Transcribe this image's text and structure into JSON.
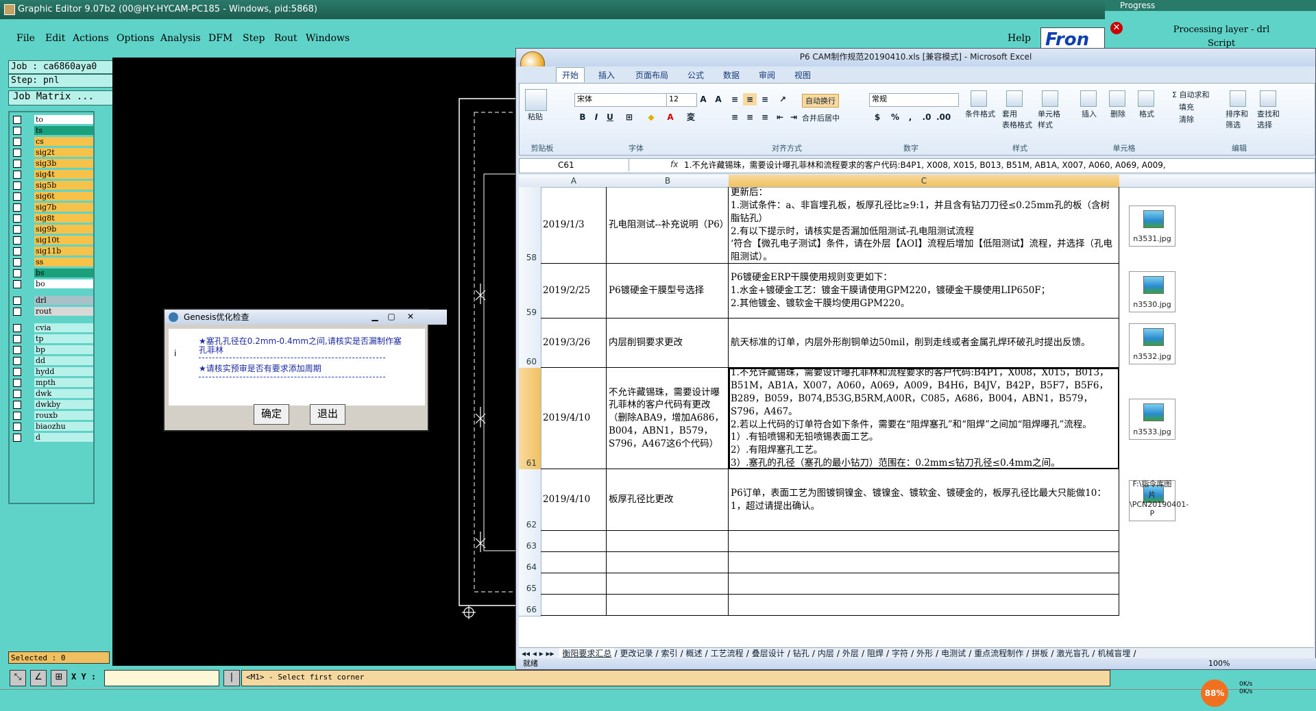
{
  "ge": {
    "title": "Graphic Editor 9.07b2 (00@HY-HYCAM-PC185 - Windows, pid:5868)",
    "menus": [
      "File",
      "Edit",
      "Actions",
      "Options",
      "Analysis",
      "DFM",
      "Step",
      "Rout",
      "Windows"
    ],
    "help": "Help",
    "brand": "Fron",
    "job_label": "Job : ca6860aya0",
    "step_label": "Step: pnl",
    "job_matrix": "Job Matrix ...",
    "layers_group1": [
      {
        "name": "to",
        "color": "#ffffff"
      },
      {
        "name": "ts",
        "color": "#1aa07a"
      },
      {
        "name": "cs",
        "color": "#f6c24a"
      },
      {
        "name": "sig2t",
        "color": "#f6c24a"
      },
      {
        "name": "sig3b",
        "color": "#f6c24a"
      },
      {
        "name": "sig4t",
        "color": "#f6c24a"
      },
      {
        "name": "sig5b",
        "color": "#f6c24a"
      },
      {
        "name": "sig6t",
        "color": "#f6c24a"
      },
      {
        "name": "sig7b",
        "color": "#f6c24a"
      },
      {
        "name": "sig8t",
        "color": "#f6c24a"
      },
      {
        "name": "sig9b",
        "color": "#f6c24a"
      },
      {
        "name": "sig10t",
        "color": "#f6c24a"
      },
      {
        "name": "sig11b",
        "color": "#f6c24a"
      },
      {
        "name": "ss",
        "color": "#f6c24a"
      },
      {
        "name": "bs",
        "color": "#1aa07a"
      },
      {
        "name": "bo",
        "color": "#ffffff"
      }
    ],
    "layers_group2": [
      {
        "name": "drl",
        "color": "#a8c0c8"
      },
      {
        "name": "rout",
        "color": "#d8d8d8"
      }
    ],
    "layers_group3": [
      {
        "name": "cvia",
        "color": "#b8f0ea"
      },
      {
        "name": "tp",
        "color": "#b8f0ea"
      },
      {
        "name": "bp",
        "color": "#b8f0ea"
      },
      {
        "name": "dd",
        "color": "#b8f0ea"
      },
      {
        "name": "hydd",
        "color": "#b8f0ea"
      },
      {
        "name": "mpth",
        "color": "#b8f0ea"
      },
      {
        "name": "dwk",
        "color": "#b8f0ea"
      },
      {
        "name": "dwkby",
        "color": "#b8f0ea"
      },
      {
        "name": "rouxb",
        "color": "#b8f0ea"
      },
      {
        "name": "biaozhu",
        "color": "#b8f0ea"
      },
      {
        "name": "d",
        "color": "#b8f0ea"
      }
    ],
    "selected": "Selected : 0",
    "xy_label": "X Y :",
    "prompt": "<M1> - Select first corner"
  },
  "progress": {
    "title": "Progress",
    "line1": "Processing layer - drl",
    "line2": "Script"
  },
  "genesis": {
    "title": "Genesis优化检查",
    "msg1": "★塞孔孔径在0.2mm-0.4mm之间,请核实是否漏制作塞孔菲林",
    "msg2": "★请核实预审是否有要求添加周期",
    "ok": "确定",
    "exit": "退出"
  },
  "excel": {
    "title": "P6 CAM制作规范20190410.xls  [兼容模式] - Microsoft Excel",
    "tabs": [
      "开始",
      "插入",
      "页面布局",
      "公式",
      "数据",
      "审阅",
      "视图"
    ],
    "ribbon": {
      "paste": "粘贴",
      "clipboard": "剪贴板",
      "font_name": "宋体",
      "font_size": "12",
      "font": "字体",
      "wrap": "自动换行",
      "merge": "合并后居中",
      "align": "对齐方式",
      "number_format": "常规",
      "number": "数字",
      "cond_format": "条件格式",
      "table_format": "套用\n表格格式",
      "cell_style": "单元格\n样式",
      "styles": "样式",
      "insert": "插入",
      "delete": "删除",
      "format": "格式",
      "cells": "单元格",
      "autosum": "Σ 自动求和",
      "fill": "填充",
      "clear": "清除",
      "sort": "排序和\n筛选",
      "find": "查找和\n选择",
      "editing": "编辑"
    },
    "namebox": "C61",
    "formula": "1.不允许藏锡珠，需要设计曝孔菲林和流程要求的客户代码:B4P1, X008, X015, B013, B51M, AB1A, X007, A060, A069, A009,",
    "columns": [
      "A",
      "B",
      "C"
    ],
    "rows": [
      {
        "num": "58",
        "date": "2019/1/3",
        "title": "孔电阻测试--补充说明（P6）",
        "content": "更新后：\n1.测试条件：a、非盲埋孔板，板厚孔径比≥9:1，并且含有钻刀刀径≤0.25mm孔的板（含树脂钻孔）\n2.有以下提示时，请核实是否漏加低阻测试-孔电阻测试流程\n‘符合【微孔电子测试】条件，请在外层【AOI】流程后增加【低阻测试】流程，并选择（孔电阻测试）。",
        "image": "n3531.jpg"
      },
      {
        "num": "59",
        "date": "2019/2/25",
        "title": "P6镀硬金干膜型号选择",
        "content": "P6镀硬金ERP干膜使用规则变更如下：\n1.水金+镀硬金工艺：镀金干膜请使用GPM220，镀硬金干膜使用LIP650F；\n2.其他镀金、镀软金干膜均使用GPM220。",
        "image": "n3530.jpg"
      },
      {
        "num": "60",
        "date": "2019/3/26",
        "title": "内层削铜要求更改",
        "content": "航天标准的订单，内层外形削铜单边50mil，削到走线或者金属孔焊环破孔时提出反馈。",
        "image": "n3532.jpg"
      },
      {
        "num": "61",
        "date": "2019/4/10",
        "title": "不允许藏锡珠，需要设计曝孔菲林的客户代码有更改（删除ABA9，增加A686，B004，ABN1，B579，S796，A467这6个代码）",
        "content": "1.不允许藏锡珠，需要设计曝孔菲林和流程要求的客户代码:B4P1，X008，X015，B013，B51M，AB1A，X007，A060，A069，A009，B4H6，B4JV，B42P，B5F7，B5F6，B289，B059，B074,B53G,B5RM,A00R，C085，A686，B004，ABN1，B579，S796，A467。\n2.若以上代码的订单符合如下条件，需要在“阻焊塞孔”和“阻焊”之间加“阻焊曝孔”流程。\n1）.有铅喷锡和无铅喷锡表面工艺。\n2）.有阻焊塞孔工艺。\n3）.塞孔的孔径（塞孔的最小钻刀）范围在：0.2mm≤钻刀孔径≤0.4mm之间。",
        "image": "n3533.jpg"
      },
      {
        "num": "62",
        "date": "2019/4/10",
        "title": "板厚孔径比更改",
        "content": "P6订单，表面工艺为图镀铜镍金、镀镍金、镀软金、镀硬金的，板厚孔径比最大只能做10：1，超过请提出确认。",
        "image": "F:\\指令库图片\\PCN20190401-P"
      }
    ],
    "empty_rows": [
      "63",
      "64",
      "65",
      "66"
    ],
    "sheet_tabs": [
      "衡阳要求汇总",
      "更改记录",
      "索引",
      "概述",
      "工艺流程",
      "叠层设计",
      "钻孔",
      "内层",
      "外层",
      "阻焊",
      "字符",
      "外形",
      "电测试",
      "重点流程制作",
      "拼板",
      "激光盲孔",
      "机械盲埋"
    ],
    "status": "就绪",
    "zoom": "100%"
  },
  "tray": {
    "cpu": "88%",
    "net_up": "0K/s",
    "net_down": "0K/s"
  }
}
